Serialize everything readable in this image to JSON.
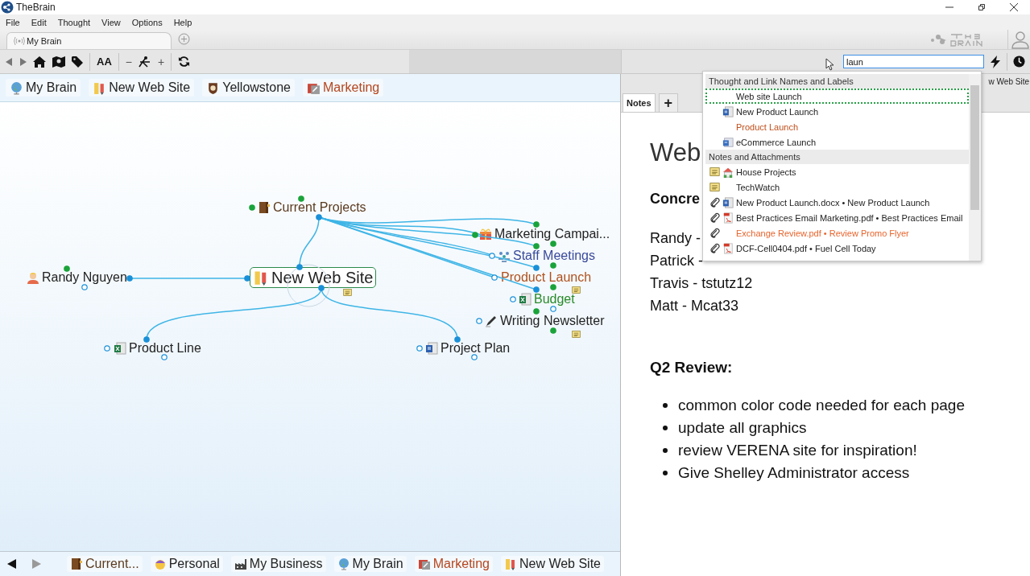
{
  "window": {
    "title": "TheBrain"
  },
  "menu": [
    "File",
    "Edit",
    "Thought",
    "View",
    "Options",
    "Help"
  ],
  "tabs": [
    {
      "label": "My Brain",
      "selected": true
    }
  ],
  "toolbar": {
    "font_size": "AA",
    "zoom_out": "−",
    "zoom_in": "+"
  },
  "search": {
    "value": "laun"
  },
  "pins": [
    {
      "label": "My Brain",
      "color": "#222222"
    },
    {
      "label": "New Web Site",
      "color": "#222222"
    },
    {
      "label": "Yellowstone",
      "color": "#222222"
    },
    {
      "label": "Marketing",
      "color": "#b5461f"
    }
  ],
  "plex": {
    "nodes": [
      {
        "label": "Current Projects",
        "color": "#5b3a1e",
        "selected": false
      },
      {
        "label": "Marketing Campai...",
        "color": "#222222",
        "selected": false
      },
      {
        "label": "Staff Meetings",
        "color": "#3a4a9a",
        "selected": false
      },
      {
        "label": "Product Launch",
        "color": "#b0501c",
        "selected": false
      },
      {
        "label": "Budget",
        "color": "#2a8a2a",
        "selected": false
      },
      {
        "label": "Writing Newsletter",
        "color": "#222222",
        "selected": false
      },
      {
        "label": "Randy Nguyen",
        "color": "#222222",
        "selected": false
      },
      {
        "label": "New Web Site",
        "color": "#222222",
        "selected": true
      },
      {
        "label": "Product Line",
        "color": "#222222",
        "selected": false
      },
      {
        "label": "Project Plan",
        "color": "#222222",
        "selected": false
      }
    ]
  },
  "history": [
    {
      "label": "Current...",
      "color": "#5b3a1e"
    },
    {
      "label": "Personal",
      "color": "#222222"
    },
    {
      "label": "My Business",
      "color": "#222222"
    },
    {
      "label": "My Brain",
      "color": "#222222"
    },
    {
      "label": "Marketing",
      "color": "#b5461f"
    },
    {
      "label": "New Web Site",
      "color": "#222222"
    }
  ],
  "notes_panel": {
    "tabs": [
      {
        "label": "Notes",
        "selected": true
      },
      {
        "label": "+",
        "selected": false
      }
    ],
    "path_label": "w Web Site",
    "title": "Web",
    "heading": "Concre",
    "lines": [
      "Randy -",
      "Patrick -",
      "Travis - tstutz12",
      "Matt - Mcat33"
    ],
    "review_heading": "Q2 Review:",
    "bullets": [
      "common color code needed for each page",
      "update all graphics",
      "review VERENA site for inspiration!",
      "Give Shelley Administrator access"
    ]
  },
  "search_results": {
    "sections": [
      {
        "heading": "Thought and Link Names and Labels",
        "items": [
          {
            "label": "Web site Launch",
            "color": "#222222",
            "selected": true
          },
          {
            "label": "New Product Launch",
            "color": "#222222",
            "selected": false
          },
          {
            "label": "Product Launch",
            "color": "#c0501c",
            "selected": false
          },
          {
            "label": "eCommerce Launch",
            "color": "#222222",
            "selected": false
          }
        ]
      },
      {
        "heading": "Notes and Attachments",
        "items": [
          {
            "label": "House Projects",
            "color": "#222222",
            "selected": false
          },
          {
            "label": "TechWatch",
            "color": "#222222",
            "selected": false
          },
          {
            "label": "New Product Launch.docx • New Product Launch",
            "color": "#222222",
            "selected": false
          },
          {
            "label": "Best Practices Email Marketing.pdf • Best Practices Email",
            "color": "#222222",
            "selected": false
          },
          {
            "label": "Exchange Review.pdf • Review Promo Flyer",
            "color": "#e8642c",
            "selected": false
          },
          {
            "label": "DCF-Cell0404.pdf • Fuel Cell Today",
            "color": "#222222",
            "selected": false
          }
        ]
      }
    ]
  }
}
